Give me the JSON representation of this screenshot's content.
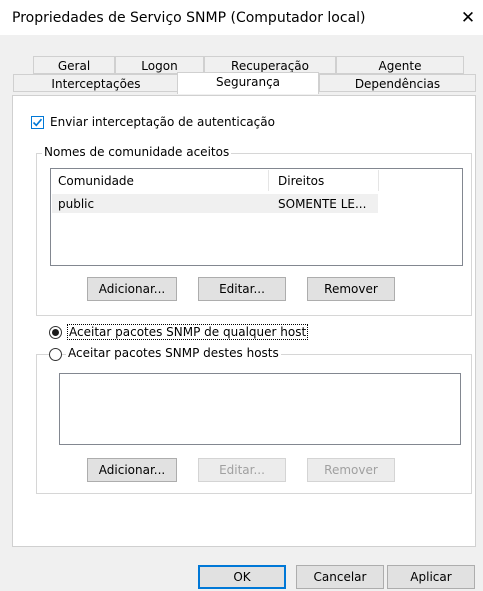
{
  "window": {
    "title": "Propriedades de Serviço SNMP (Computador local)",
    "close_glyph": "✕"
  },
  "tabs_row1": [
    "Geral",
    "Logon",
    "Recuperação",
    "Agente"
  ],
  "tabs_row2": [
    "Interceptações",
    "Segurança",
    "Dependências"
  ],
  "active_tab": "Segurança",
  "auth_trap": {
    "label": "Enviar interceptação de autenticação",
    "checked": true
  },
  "community_group": {
    "label": "Nomes de comunidade aceitos",
    "columns": [
      "Comunidade",
      "Direitos"
    ],
    "rows": [
      {
        "community": "public",
        "rights": "SOMENTE LE..."
      }
    ],
    "buttons": {
      "add": "Adicionar...",
      "edit": "Editar...",
      "remove": "Remover"
    }
  },
  "hosts": {
    "any_host_label": "Aceitar pacotes SNMP de qualquer host",
    "these_hosts_label": "Aceitar pacotes SNMP destes hosts",
    "selected": "any",
    "buttons": {
      "add": "Adicionar...",
      "edit": "Editar...",
      "remove": "Remover"
    }
  },
  "footer": {
    "ok": "OK",
    "cancel": "Cancelar",
    "apply": "Aplicar"
  },
  "colors": {
    "check_accent": "#0078d7",
    "row_selected": "#f0f0f0"
  }
}
